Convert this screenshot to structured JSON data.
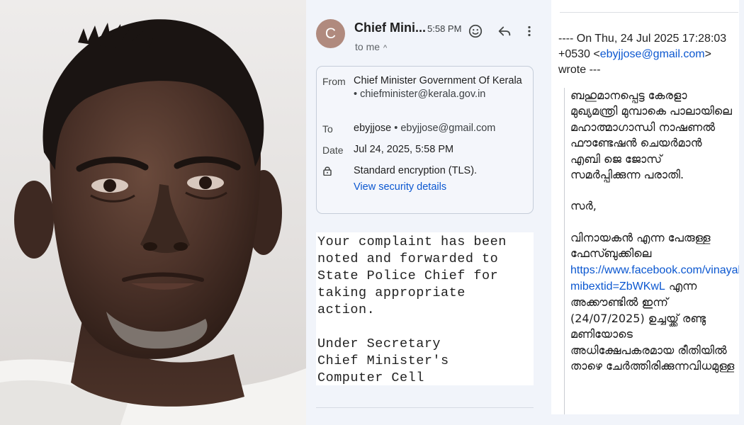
{
  "email": {
    "avatar_letter": "C",
    "sender_short": "Chief Mini...",
    "time": "5:58 PM",
    "to_me": "to me",
    "details": {
      "from_label": "From",
      "from_name": "Chief Minister Government Of Kerala",
      "from_email": "chiefminister@kerala.gov.in",
      "to_label": "To",
      "to_name": "ebyjjose",
      "to_email": "ebyjjose@gmail.com",
      "date_label": "Date",
      "date_value": "Jul 24, 2025, 5:58 PM",
      "encryption": "Standard encryption (TLS).",
      "security_link": "View security details"
    },
    "body_lines": [
      "Your complaint has been",
      "noted and forwarded to",
      "State Police Chief for",
      "taking appropriate",
      "action.",
      "",
      "Under Secretary",
      "Chief Minister's",
      "Computer Cell"
    ]
  },
  "quoted": {
    "header_prefix": "---- On Thu, 24 Jul 2025 17:28:03 +0530 <",
    "header_email": "ebyjjose@gmail.com",
    "header_suffix": "> wrote ---",
    "para1": "ബഹുമാനപ്പെട്ട കേരളാ മുഖ്യമന്ത്രി മുമ്പാകെ പാലായിലെ മഹാത്മാഗാന്ധി നാഷണൽ ഫൗണ്ടേഷൻ ചെയർമാൻ എബി ജെ ജോസ് സമർപ്പിക്കുന്ന പരാതി.",
    "salutation": "സർ,",
    "para3_start": "വിനായകൻ എന്ന പേരുള്ള ഫേസ്ബുക്കിലെ",
    "fb_link": "https://www.facebook.com/vinayakanactor?mibextid=ZbWKwL",
    "para3_end": "എന്ന അക്കൗണ്ടിൽ ഇന്ന് (24/07/2025) ഉച്ചയ്ക്ക് രണ്ടു മണിയോടെ അധിക്ഷേപകരമായ രീതിയിൽ താഴെ ചേർത്തിരിക്കുന്നവിധമുള്ള"
  },
  "colors": {
    "panel_bg": "#f1f4fa",
    "link": "#0b57d0",
    "avatar": "#b08a7e"
  }
}
